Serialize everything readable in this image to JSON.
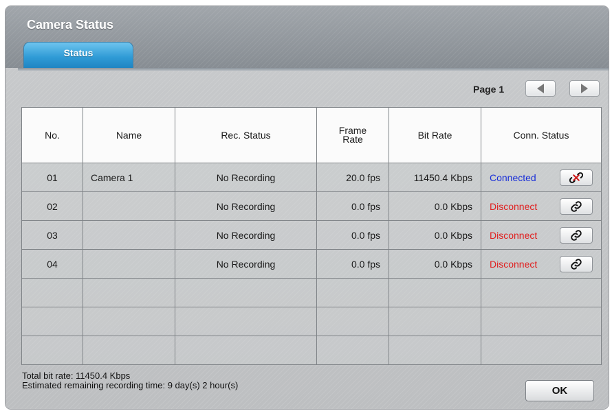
{
  "window": {
    "title": "Camera Status"
  },
  "tabs": [
    {
      "label": "Status",
      "active": true
    }
  ],
  "pager": {
    "label": "Page 1",
    "prev_icon": "triangle-left-icon",
    "next_icon": "triangle-right-icon"
  },
  "table": {
    "headers": [
      "No.",
      "Name",
      "Rec. Status",
      "Frame\nRate",
      "Bit Rate",
      "Conn. Status"
    ],
    "rows": [
      {
        "no": "01",
        "name": "Camera 1",
        "rec": "No Recording",
        "fps": "20.0 fps",
        "bitrate": "11450.4 Kbps",
        "conn": "Connected",
        "action_icon": "broken-link-icon"
      },
      {
        "no": "02",
        "name": "",
        "rec": "No Recording",
        "fps": "0.0 fps",
        "bitrate": "0.0 Kbps",
        "conn": "Disconnect",
        "action_icon": "link-icon"
      },
      {
        "no": "03",
        "name": "",
        "rec": "No Recording",
        "fps": "0.0 fps",
        "bitrate": "0.0 Kbps",
        "conn": "Disconnect",
        "action_icon": "link-icon"
      },
      {
        "no": "04",
        "name": "",
        "rec": "No Recording",
        "fps": "0.0 fps",
        "bitrate": "0.0 Kbps",
        "conn": "Disconnect",
        "action_icon": "link-icon"
      },
      {
        "no": "",
        "name": "",
        "rec": "",
        "fps": "",
        "bitrate": "",
        "conn": ""
      },
      {
        "no": "",
        "name": "",
        "rec": "",
        "fps": "",
        "bitrate": "",
        "conn": ""
      },
      {
        "no": "",
        "name": "",
        "rec": "",
        "fps": "",
        "bitrate": "",
        "conn": ""
      }
    ]
  },
  "footer": {
    "total_bit_rate": "Total bit rate: 11450.4 Kbps",
    "remaining_time": "Estimated remaining recording time: 9 day(s) 2 hour(s)"
  },
  "ok_label": "OK",
  "colors": {
    "connected": "#1a2fd8",
    "disconnect": "#e02020",
    "tab_active": "#2f9bd6"
  }
}
